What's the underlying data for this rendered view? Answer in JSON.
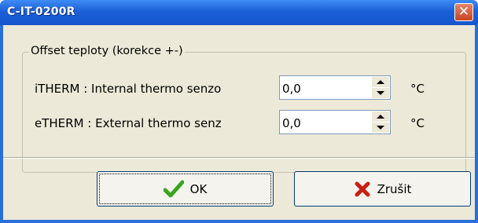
{
  "window": {
    "title": "C-IT-0200R",
    "close_glyph": "✕"
  },
  "group": {
    "legend": "Offset teploty (korekce +-)"
  },
  "fields": [
    {
      "label": "iTHERM : Internal thermo senzo",
      "value": "0,0",
      "unit": "°C"
    },
    {
      "label": "eTHERM : External thermo senz",
      "value": "0,0",
      "unit": "°C"
    }
  ],
  "buttons": {
    "ok_label": "OK",
    "cancel_label": "Zrušit"
  },
  "icons": {
    "ok": "checkmark-icon",
    "cancel": "cross-icon",
    "ok_color": "#3aa41e",
    "cancel_color": "#c81e14"
  }
}
